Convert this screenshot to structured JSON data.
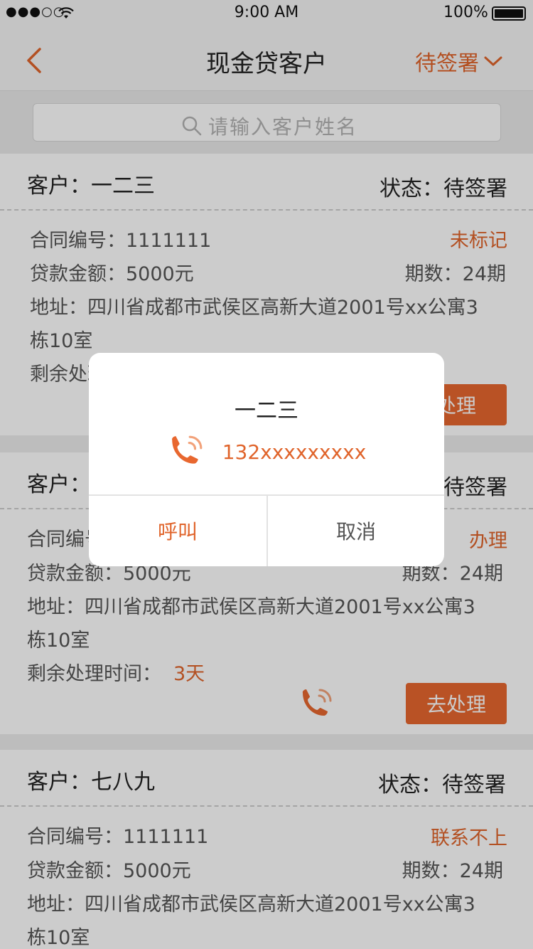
{
  "status_bar": {
    "signal": "●●●○○",
    "time": "9:00 AM",
    "battery": "100%"
  },
  "nav": {
    "title": "现金贷客户",
    "filter": "待签署"
  },
  "search": {
    "placeholder": "请输入客户姓名"
  },
  "cards": [
    {
      "customer": "客户：一二三",
      "status": "状态：待签署",
      "contract": "合同编号：1111111",
      "tag": "未标记",
      "amount": "贷款金额：5000元",
      "term": "期数：24期",
      "address1": "地址：四川省成都市武侯区高新大道2001号xx公寓3",
      "address2": "栋10室",
      "remaining_label": "剩余处理时间：",
      "remaining_value": "",
      "action": "处理"
    },
    {
      "customer": "客户：",
      "status": "待签署",
      "contract": "合同编号",
      "tag": "办理",
      "amount": "贷款金额：5000元",
      "term": "期数：24期",
      "address1": "地址：四川省成都市武侯区高新大道2001号xx公寓3",
      "address2": "栋10室",
      "remaining_label": "剩余处理时间：",
      "remaining_value": "3天",
      "action": "去处理"
    },
    {
      "customer": "客户：七八九",
      "status": "状态：待签署",
      "contract": "合同编号：1111111",
      "tag": "联系不上",
      "amount": "贷款金额：5000元",
      "term": "期数：24期",
      "address1": "地址：四川省成都市武侯区高新大道2001号xx公寓3",
      "address2": "栋10室"
    }
  ],
  "dialog": {
    "name": "一二三",
    "phone": "132xxxxxxxxx",
    "call": "呼叫",
    "cancel": "取消"
  },
  "colors": {
    "accent": "#e0642b",
    "button": "#e8672f"
  }
}
